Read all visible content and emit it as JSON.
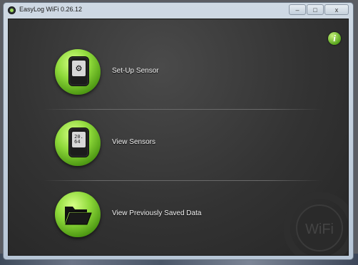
{
  "window": {
    "title": "EasyLog WiFi 0.26.12"
  },
  "title_buttons": {
    "minimize": "–",
    "maximize": "□",
    "close": "x"
  },
  "info_button": {
    "symbol": "i"
  },
  "menu": [
    {
      "label": "Set-Up Sensor",
      "icon": "gear-device-icon"
    },
    {
      "label": "View Sensors",
      "icon": "sensor-display-icon"
    },
    {
      "label": "View Previously Saved Data",
      "icon": "folder-icon"
    }
  ],
  "sensor_screen": {
    "line1": "20.",
    "line2": "64"
  },
  "watermark": {
    "text": "WiFi"
  },
  "colors": {
    "accent_green": "#8ed93a",
    "background": "#333333",
    "label_text": "#f2f2f2"
  }
}
